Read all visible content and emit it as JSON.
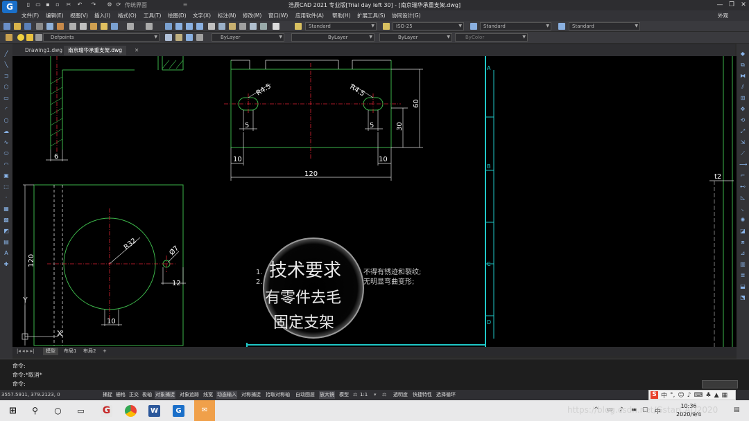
{
  "window": {
    "title": "浩辰CAD 2021 专业版[Trial day left 30] - [南京瑞华承重支架.dwg]",
    "workspace": "传统界面",
    "logo": "G"
  },
  "menu": {
    "items": [
      "文件(F)",
      "编辑(E)",
      "视图(V)",
      "插入(I)",
      "格式(O)",
      "工具(T)",
      "绘图(D)",
      "文字(X)",
      "标注(N)",
      "修改(M)",
      "窗口(W)",
      "应用软件(A)",
      "帮助(H)",
      "扩展工具(S)",
      "协同设计(G)"
    ],
    "appearance": "外观"
  },
  "toolbar": {
    "text_style": "Standard",
    "dim_style": "ISO-25",
    "table_style": "Standard",
    "multileader_style": "Standard",
    "layer": "Defpoints",
    "color": "ByLayer",
    "linetype": "ByLayer",
    "lineweight": "ByLayer",
    "plot_style": "ByColor"
  },
  "doc_tabs": [
    "Drawing1.dwg",
    "南京瑞华承重支架.dwg"
  ],
  "drawing": {
    "dims": {
      "d6": "6",
      "r45a": "R4.5",
      "r45b": "R4.5",
      "d5a": "5",
      "d5b": "5",
      "d10a": "10",
      "d10b": "10",
      "d120h": "120",
      "d60": "60",
      "d30": "30",
      "r32": "R32",
      "phi7": "Ø7",
      "d12": "12",
      "d10c": "10",
      "d120v": "120",
      "t2": "t2"
    },
    "frame_zones": [
      "A",
      "B",
      "C",
      "D"
    ],
    "ucs": {
      "y": "Y",
      "x": "X"
    },
    "notes": {
      "heading": "技术要求",
      "n1_num": "1.",
      "n1": "不得有锈迹和裂纹;",
      "n2_num": "2.",
      "n2": "无明显弯曲变形;",
      "zoom_l2": "有零件去毛",
      "zoom_l3": "固定支架"
    }
  },
  "layout_tabs": [
    "模型",
    "布局1",
    "布局2",
    "+"
  ],
  "command": {
    "line1": "命令:",
    "line2": "命令:*取消*",
    "line3": "命令:"
  },
  "status": {
    "coords": "3557.5911, 379.2123, 0",
    "buttons": [
      "捕捉",
      "栅格",
      "正交",
      "极轴",
      "对象捕捉",
      "对象追踪",
      "线宽",
      "动态输入",
      "对称捕捉",
      "拾取对称轴",
      "自动图层",
      "放大镜",
      "模型"
    ],
    "scale": "1:1",
    "extra": [
      "透明度",
      "快捷特性",
      "选择循环"
    ]
  },
  "taskbar": {
    "time": "10:36",
    "date": "2020/9/4",
    "ime": "中",
    "watermark": "https://blog.csdn.net/GstarCAD2020"
  }
}
